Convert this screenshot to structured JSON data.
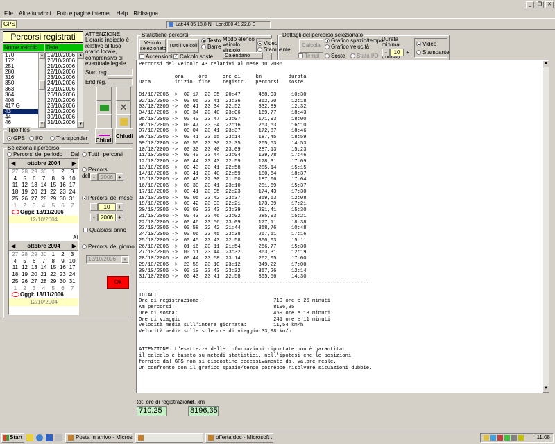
{
  "menu": {
    "items": [
      "File",
      "Altre funzioni",
      "Foto e pagine internet",
      "Help",
      "Ridisegna"
    ]
  },
  "toolbar": {
    "gps_label": "GPS",
    "coordinates": "Lat:44 35 18,8 N - Lon:000 41 22,8 E"
  },
  "left": {
    "title": "Percorsi registrati",
    "col_vehicle": "Nome veicolo",
    "col_date": "Data",
    "vehicles": [
      "170",
      "172",
      "251",
      "280",
      "316",
      "350",
      "363",
      "364",
      "408",
      "417.G",
      "43",
      "44",
      "46"
    ],
    "selected_vehicle": "43",
    "dates": [
      "19/10/2006",
      "20/10/2006",
      "21/10/2006",
      "22/10/2006",
      "23/10/2006",
      "24/10/2006",
      "25/10/2006",
      "26/10/2006",
      "27/10/2006",
      "28/10/2006",
      "29/10/2006",
      "30/10/2006",
      "31/10/2006"
    ],
    "attention": "ATTENZIONE: L'orario indicato è relativo al fuso orario locale, comprensivo di eventuale legale.",
    "start_reg": "Start reg.",
    "end_reg": "End reg.",
    "chiudi1": "Chiudi",
    "chiudi2": "Chiudi"
  },
  "filetype": {
    "title": "Tipo files",
    "options": [
      "GPS",
      "I/O",
      "Transponder"
    ],
    "selected": "GPS"
  },
  "selection": {
    "title": "Seleziona il percorso",
    "period_label": "Percorsi del periodo",
    "dal": "Dal",
    "al": "Al",
    "cal_month": "ottobre 2004",
    "cal_days": [
      "27",
      "28",
      "29",
      "30",
      "1",
      "2",
      "3",
      "4",
      "5",
      "6",
      "7",
      "8",
      "9",
      "10",
      "11",
      "12",
      "13",
      "14",
      "15",
      "16",
      "17",
      "18",
      "19",
      "20",
      "21",
      "22",
      "23",
      "24",
      "25",
      "26",
      "27",
      "28",
      "29",
      "30",
      "31",
      "1",
      "2",
      "3",
      "4",
      "5",
      "6",
      "7"
    ],
    "today": "Oggi: 13/11/2006",
    "cal1_value": "12/10/2004",
    "cal2_value": "12/10/2004",
    "all_label": "Tutti i percorsi",
    "year_label": "Percorsi dell'anno",
    "year_value": "2006",
    "month_label": "Percorsi del mese",
    "month_value": "10",
    "month_year_value": "2006",
    "any_year": "Qualsiasi anno",
    "day_label": "Percorsi del giorno",
    "day_value": "12/10/2006",
    "ok": "Ok"
  },
  "stats": {
    "title": "Statistiche percorsi",
    "btn_vehicle": "Veicolo selezionato",
    "btn_all": "Tutti i veicoli",
    "opt_text": "Testo",
    "opt_bars": "Barre",
    "mode_label": "Modo elenco veicolo singolo",
    "opt_video": "Video",
    "opt_print": "Stampante",
    "chk_on": "Accensioni",
    "chk_stops": "Calcolo soste",
    "calendar": "Calendario"
  },
  "details": {
    "title": "Dettagli del percorso selezionato",
    "calc": "Calcola",
    "opt_graph_space": "Grafico spazio/tempo",
    "opt_graph_speed": "Grafico velocità",
    "opt_stops": "Soste",
    "opt_io": "Stato I/O",
    "opt_tempi": "Tempi",
    "min_stop_label": "Durata minima sosta (minuti)",
    "min_stop_value": "10",
    "opt_video": "Video",
    "opt_print": "Stampante"
  },
  "report": {
    "text": "Percorsi del veicolo 43 relativi al mese 10 2006\n\n            ora     ora     ore di     km         durata\nData        inizio  fine    registr.   percorsi   soste\n\n01/10/2006 ->  02.17  23.05  20:47      458,03     10:30\n02/10/2006 ->  00.05  23.41  23:36      362,20     12:18\n03/10/2006 ->  00.41  23.34  22:52      332,89     12:32\n04/10/2006 ->  00.34  23.40  23:06      169,77     18:43\n05/10/2006 ->  00.40  23.47  23:07      171,93     18:00\n06/10/2006 ->  00.47  23.04  22:16      253,53     16:10\n07/10/2006 ->  00.04  23.41  23:37      172,87     18:46\n08/10/2006 ->  00.41  23.55  23:14      187,45     18:59\n09/10/2006 ->  00.55  23.30  22:35      265,53     14:53\n10/10/2006 ->  00.30  23.40  23:09      287,13     15:23\n11/10/2006 ->  00.40  23.44  23:04      139,78     17:46\n12/10/2006 ->  00.44  23.43  22:59      178,31     17:09\n13/10/2006 ->  00.43  23.41  22:58      285,14     15:15\n14/10/2006 ->  00.41  23.40  22:59      180,64     18:37\n15/10/2006 ->  00.40  22.30  21:50      187,06     17:04\n16/10/2006 ->  00.30  23.41  23:10      281,69     15:37\n17/10/2006 ->  00.41  23.05  22:23      174,43     17:30\n18/10/2006 ->  00.05  23.42  23:37      359,63     12:08\n19/10/2006 ->  00.42  23.03  22:21      173,39     17:21\n20/10/2006 ->  00.03  23.43  23:39      291,41     15:30\n21/10/2006 ->  00.43  23.46  23:02      285,93     15:21\n22/10/2006 ->  00.46  23.56  23:09      177,11     18:38\n23/10/2006 ->  00.58  22.42  21:44      358,76     10:48\n24/10/2006 ->  00.06  23.45  23:38      267,51     17:16\n25/10/2006 ->  00.45  23.43  22:58      300,03     15:11\n26/10/2006 ->  01.16  23.11  21:54      256,77     15:30\n27/10/2006 ->  00.11  23.44  23:32      363,31     12:19\n28/10/2006 ->  00.44  23.58  23:14      262,05     17:00\n29/10/2006 ->  23.58  23.10  23:12      349,22     17:00\n30/10/2006 ->  00.10  23.43  23:32      357,26     12:14\n31/10/2006 ->  00.43  23.41  22:58      305,56     14:30\n-----------------------------------------------------------------------------\n\nTOTALI\nOre di registrazione:                        710 ore e 25 minuti\nKm percorsi:                                 8196,35\nOre di sosta:                                469 ore e 13 minuti\nOre di viaggio:                              241 ore e 11 minuti\nVelocità media sull'intera giornata:         11,54 km/h\nVelocità media sulle sole ore di viaggio:33,98 km/h\n\n\nATTENZIONE: L'esattezza delle informazioni riportate non è garantita:\nil calcolo è basato su metodi statistici, nell'ipotesi che le posizioni\nfornite dal GPS non si discostino eccessivamente dal valore reale.\nUn confronto con il grafico spazio/tempo potrebbe risolvere situazioni dubbie."
  },
  "totals": {
    "reg_label": "tot. ore di registrazione",
    "reg_value": "710:25",
    "km_label": "tot. km",
    "km_value": "8196,35"
  },
  "taskbar": {
    "start": "Start",
    "items": [
      "Posta in arrivo - Microsof...",
      "",
      "offerta.doc - Microsoft ..."
    ],
    "clock": "11.08"
  }
}
